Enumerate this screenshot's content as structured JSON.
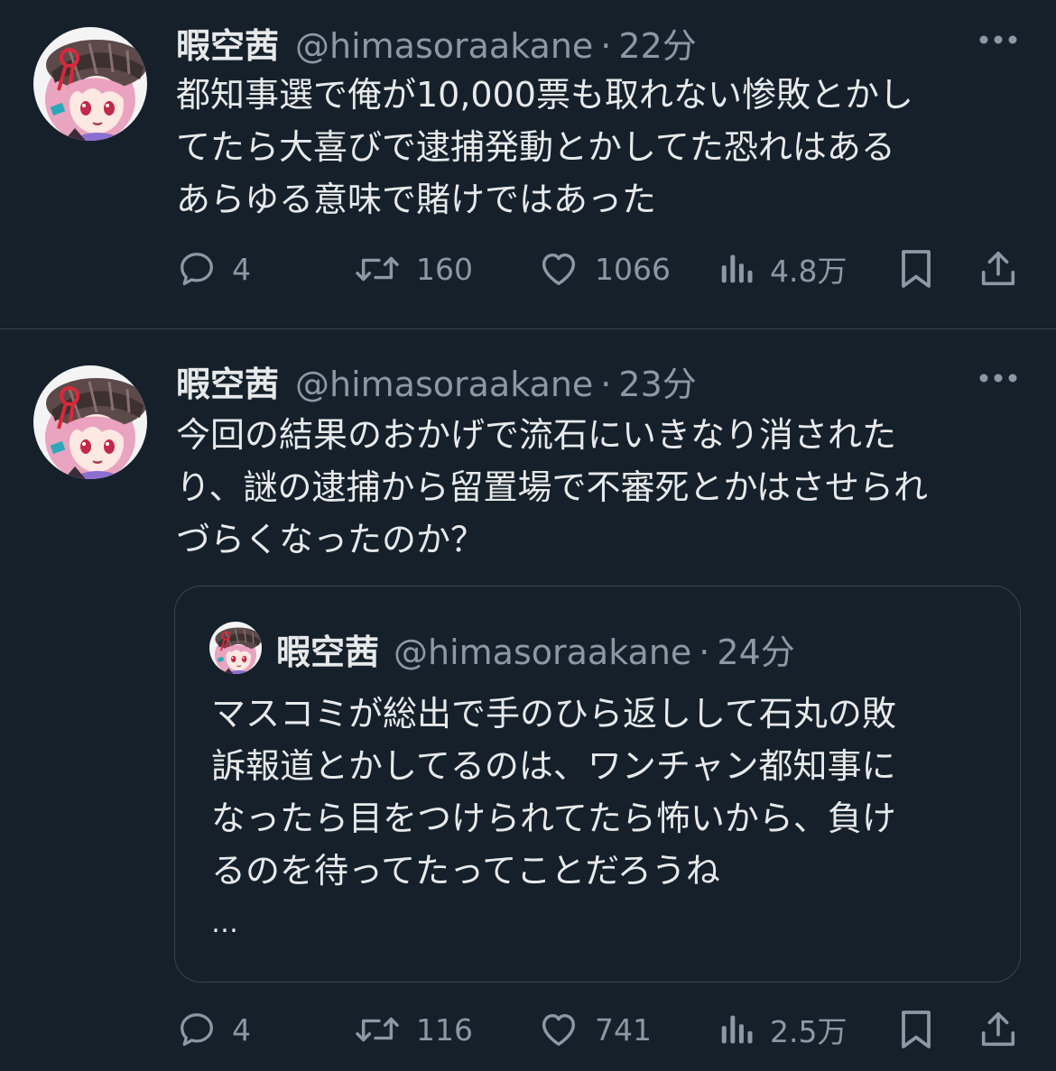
{
  "tweets": [
    {
      "author": {
        "name": "暇空茜",
        "handle": "@himasoraakane",
        "avatar_icon": "avatar-girl-pink-hair-hat"
      },
      "separator": "·",
      "time": "22分",
      "text": "都知事選で俺が10,000票も取れない惨敗とかし\nてたら大喜びで逮捕発動とかしてた恐れはある\nあらゆる意味で賭けではあった",
      "actions": {
        "reply_count": "4",
        "retweet_count": "160",
        "like_count": "1066",
        "view_count": "4.8万"
      }
    },
    {
      "author": {
        "name": "暇空茜",
        "handle": "@himasoraakane",
        "avatar_icon": "avatar-girl-pink-hair-hat"
      },
      "separator": "·",
      "time": "23分",
      "text": "今回の結果のおかげで流石にいきなり消された\nり、謎の逮捕から留置場で不審死とかはさせられ\nづらくなったのか？",
      "quote": {
        "author": {
          "name": "暇空茜",
          "handle": "@himasoraakane"
        },
        "separator": "·",
        "time": "24分",
        "text": "マスコミが総出で手のひら返しして石丸の敗\n訴報道とかしてるのは、ワンチャン都知事に\nなったら目をつけられてたら怖いから、負け\nるのを待ってたってことだろうね",
        "ellipsis": "…"
      },
      "actions": {
        "reply_count": "4",
        "retweet_count": "116",
        "like_count": "741",
        "view_count": "2.5万"
      }
    }
  ],
  "colors": {
    "background": "#15202b",
    "text_primary": "#e7e9ea",
    "text_secondary": "#8b98a5",
    "border": "#38444d"
  },
  "icons": [
    "reply-icon",
    "retweet-icon",
    "like-icon",
    "views-icon",
    "bookmark-icon",
    "share-icon",
    "more-icon"
  ]
}
